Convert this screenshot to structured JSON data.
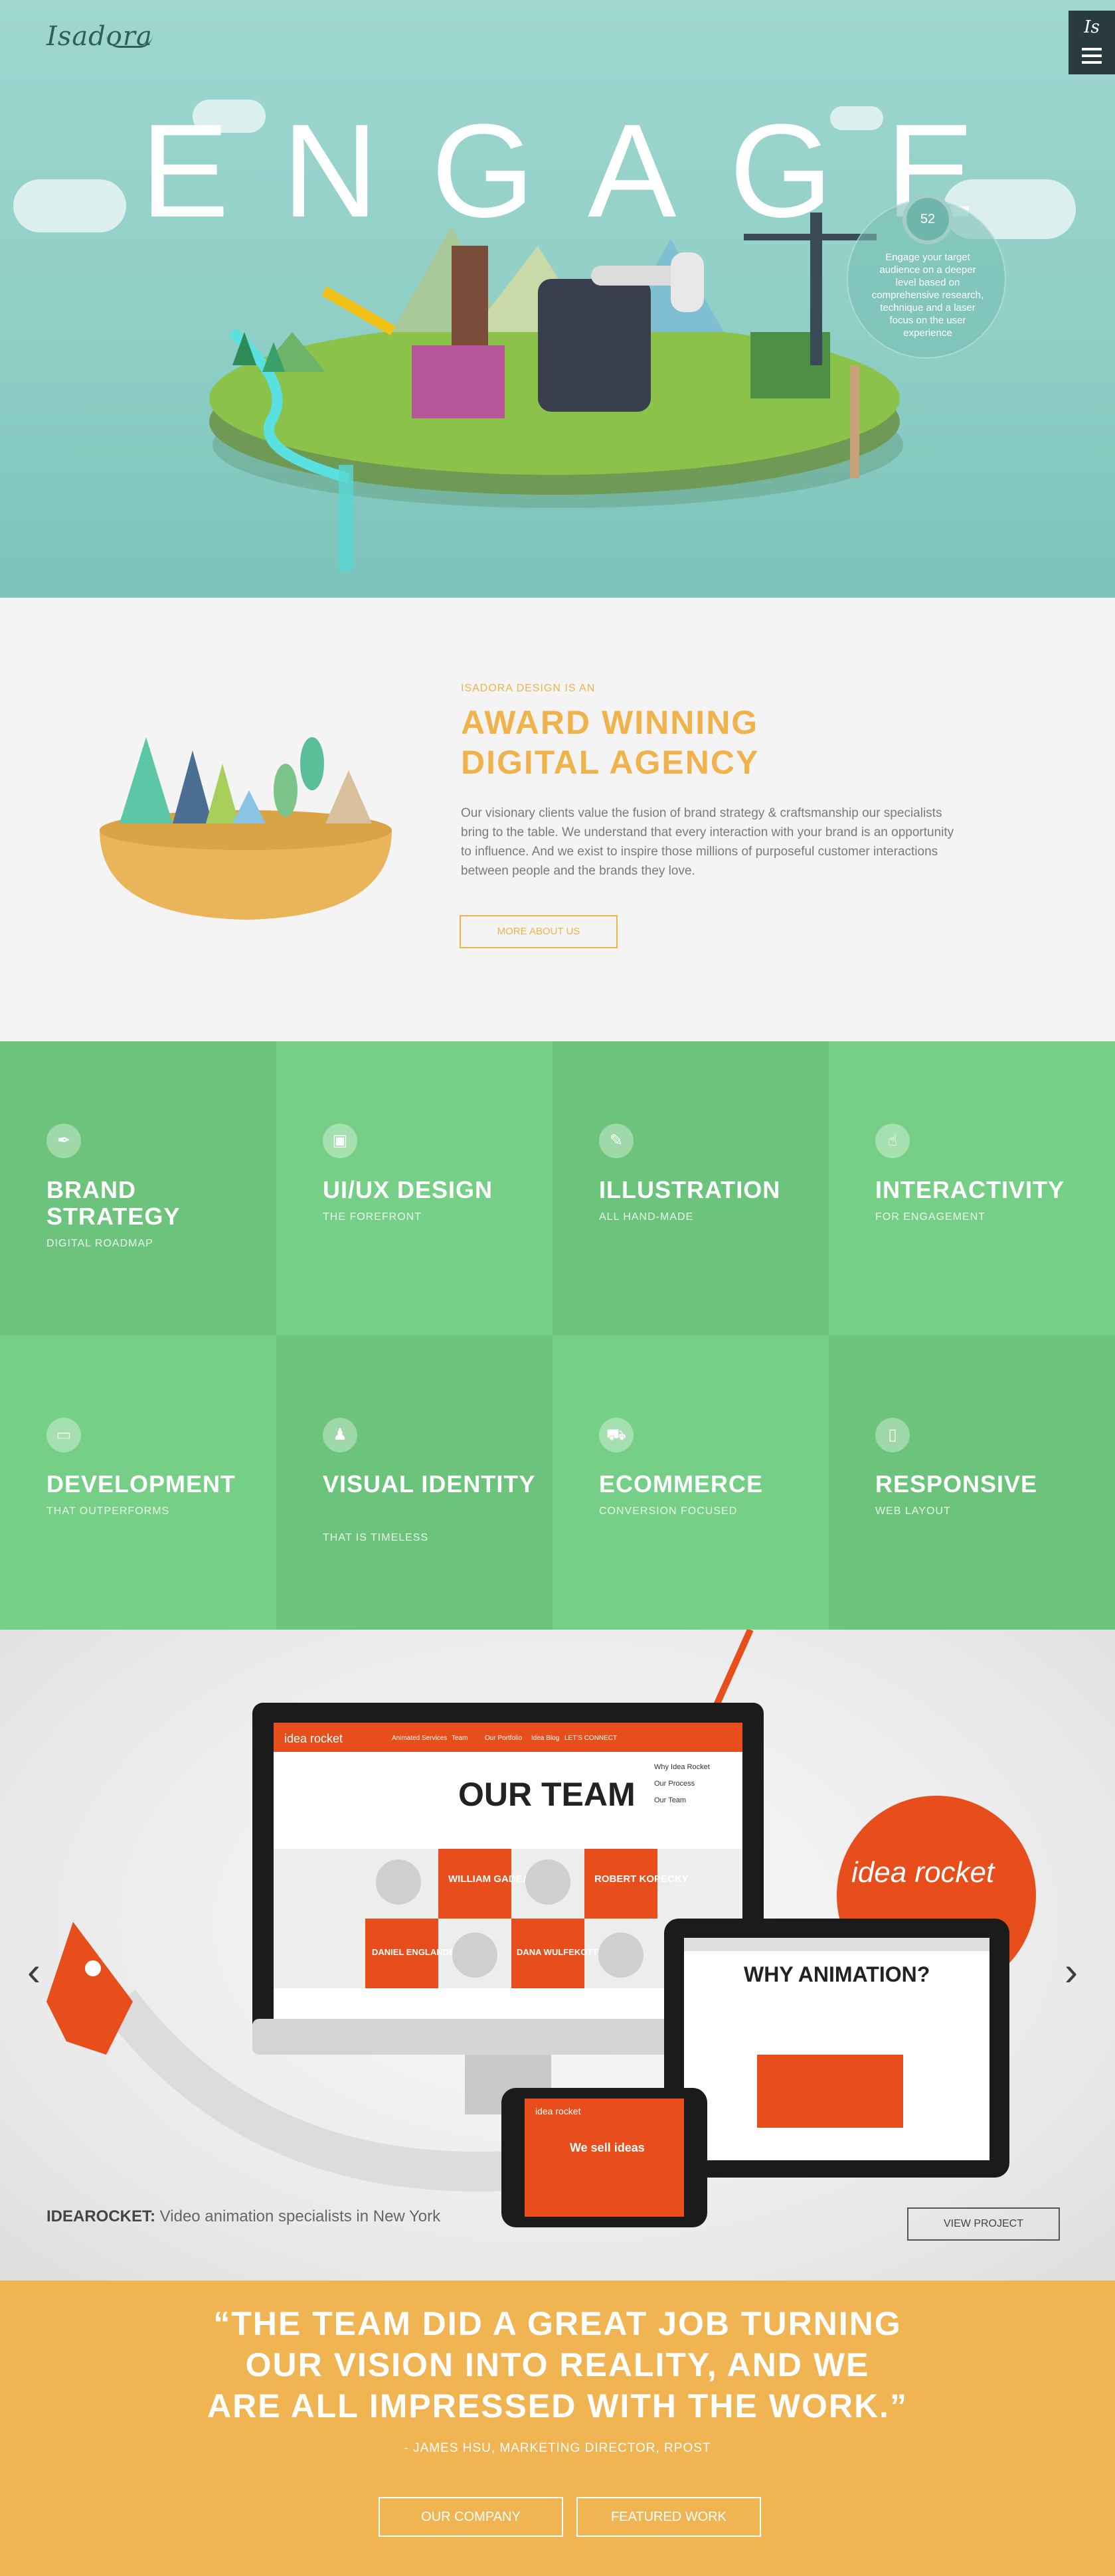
{
  "header": {
    "logo_text": "Isadora",
    "menu_mark": "Is",
    "menu_icon": "hamburger-icon"
  },
  "hero": {
    "headline": "ENGAGE",
    "badge_number": "52",
    "badge_text": "Engage your target audience on a deeper level based on comprehensive research, technique and a laser focus on the user experience"
  },
  "agency": {
    "pretitle": "ISADORA DESIGN IS AN",
    "title_line1": "AWARD WINNING",
    "title_line2": "DIGITAL AGENCY",
    "copy": "Our visionary clients value the fusion of brand strategy & craftsmanship our specialists bring to the table. We understand that every interaction with your brand is an opportunity to influence. And we exist to inspire those millions of purposeful customer interactions between people and the brands they love.",
    "button": "MORE ABOUT US",
    "accent": "#f0b24a"
  },
  "services": [
    {
      "title": "BRAND STRATEGY",
      "subtitle": "DIGITAL ROADMAP",
      "icon": "pen-nib-icon",
      "color": "#6cc47c"
    },
    {
      "title": "UI/UX DESIGN",
      "subtitle": "THE FOREFRONT",
      "icon": "layout-icon",
      "color": "#75cf86"
    },
    {
      "title": "ILLUSTRATION",
      "subtitle": "ALL HAND-MADE",
      "icon": "brush-icon",
      "color": "#6cc47c"
    },
    {
      "title": "INTERACTIVITY",
      "subtitle": "FOR ENGAGEMENT",
      "icon": "touch-icon",
      "color": "#75cf86"
    },
    {
      "title": "DEVELOPMENT",
      "subtitle": "THAT OUTPERFORMS",
      "icon": "monitor-icon",
      "color": "#75cf86"
    },
    {
      "title": "VISUAL IDENTITY",
      "subtitle": "THAT IS TIMELESS",
      "icon": "stamp-icon",
      "color": "#6cc47c"
    },
    {
      "title": "ECOMMERCE",
      "subtitle": "CONVERSION FOCUSED",
      "icon": "cart-icon",
      "color": "#75cf86"
    },
    {
      "title": "RESPONSIVE",
      "subtitle": "WEB LAYOUT",
      "icon": "phone-icon",
      "color": "#6cc47c"
    }
  ],
  "showcase": {
    "project_name": "IDEAROCKET:",
    "project_desc": " Video animation specialists in New York",
    "view_button": "VIEW PROJECT",
    "prev_icon": "chevron-left-icon",
    "next_icon": "chevron-right-icon",
    "brand_color": "#e84e1b",
    "mock": {
      "logo": "idea rocket",
      "nav": [
        "Animated Services",
        "Team",
        "Our Portfolio",
        "Idea Blog",
        "LET'S CONNECT"
      ],
      "title": "OUR TEAM",
      "side_links": [
        "Why Idea Rocket",
        "Our Process",
        "Our Team"
      ],
      "people": [
        "WILLIAM GADEA",
        "ROBERT KOPECKY",
        "DANIEL ENGLANDER",
        "DANA WULFEKOTTE"
      ],
      "tablet_title": "WHY ANIMATION?",
      "phone_text": "We sell ideas"
    }
  },
  "testimonial": {
    "quote_line1": "“THE TEAM DID A GREAT JOB TURNING",
    "quote_line2": "OUR VISION INTO REALITY, AND WE",
    "quote_line3": "ARE ALL IMPRESSED WITH THE WORK.”",
    "author": "- JAMES HSU, MARKETING DIRECTOR, RPOST",
    "button_company": "OUR COMPANY",
    "button_work": "FEATURED WORK"
  }
}
